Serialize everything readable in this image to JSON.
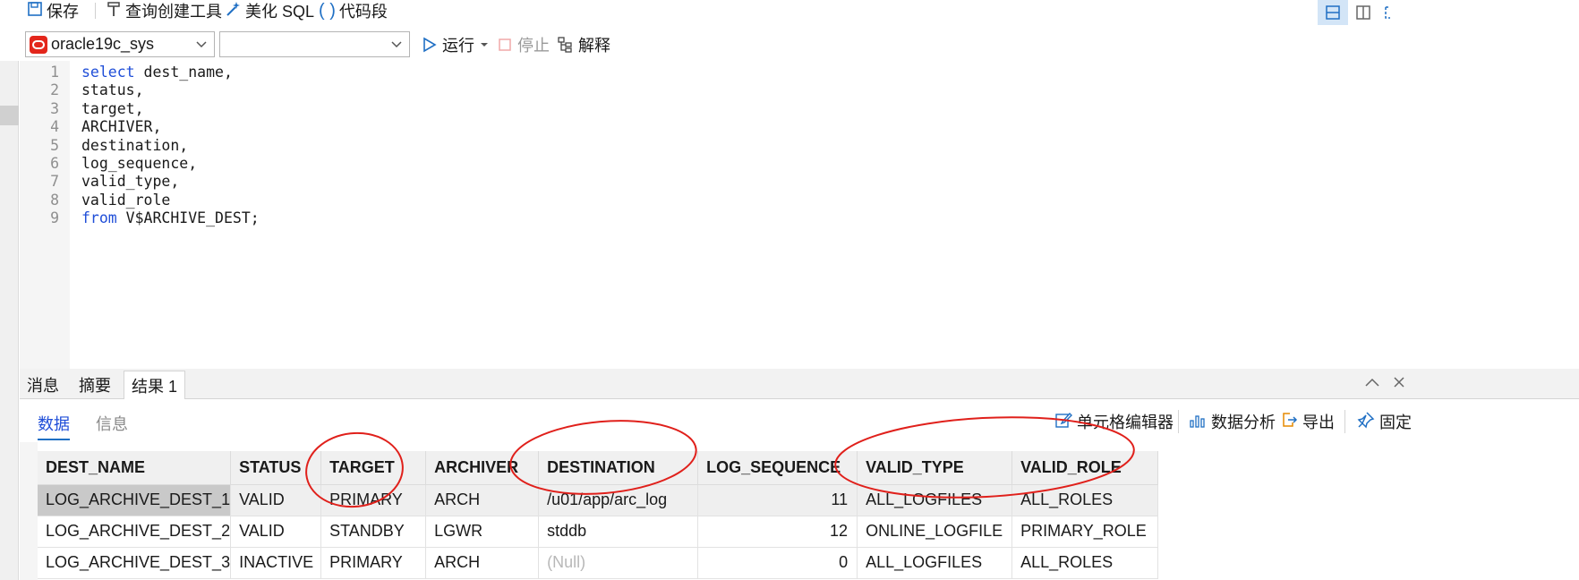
{
  "toolbar": {
    "save": "保存",
    "query_builder": "查询创建工具",
    "beautify": "美化 SQL",
    "snippet": "代码段"
  },
  "connection": {
    "selected": "oracle19c_sys",
    "schema": "",
    "run": "运行",
    "stop": "停止",
    "explain": "解释"
  },
  "editor": {
    "lines": [
      {
        "n": "1",
        "kw": "select",
        "text": " dest_name,"
      },
      {
        "n": "2",
        "kw": "",
        "text": "status,"
      },
      {
        "n": "3",
        "kw": "",
        "text": "target,"
      },
      {
        "n": "4",
        "kw": "",
        "text": "ARCHIVER,"
      },
      {
        "n": "5",
        "kw": "",
        "text": "destination,"
      },
      {
        "n": "6",
        "kw": "",
        "text": "log_sequence,"
      },
      {
        "n": "7",
        "kw": "",
        "text": "valid_type,"
      },
      {
        "n": "8",
        "kw": "",
        "text": "valid_role"
      },
      {
        "n": "9",
        "kw": "from",
        "text": " V$ARCHIVE_DEST;"
      }
    ]
  },
  "result_tabs": [
    "消息",
    "摘要",
    "结果 1"
  ],
  "sub_tabs": [
    "数据",
    "信息"
  ],
  "tools": {
    "cell_editor": "单元格编辑器",
    "data_analysis": "数据分析",
    "export": "导出",
    "pin": "固定"
  },
  "grid": {
    "columns": [
      "DEST_NAME",
      "STATUS",
      "TARGET",
      "ARCHIVER",
      "DESTINATION",
      "LOG_SEQUENCE",
      "VALID_TYPE",
      "VALID_ROLE"
    ],
    "rows": [
      [
        "LOG_ARCHIVE_DEST_1",
        "VALID",
        "PRIMARY",
        "ARCH",
        "/u01/app/arc_log",
        "11",
        "ALL_LOGFILES",
        "ALL_ROLES"
      ],
      [
        "LOG_ARCHIVE_DEST_2",
        "VALID",
        "STANDBY",
        "LGWR",
        "stddb",
        "12",
        "ONLINE_LOGFILE",
        "PRIMARY_ROLE"
      ],
      [
        "LOG_ARCHIVE_DEST_3",
        "INACTIVE",
        "PRIMARY",
        "ARCH",
        "(Null)",
        "0",
        "ALL_LOGFILES",
        "ALL_ROLES"
      ]
    ]
  },
  "colors": {
    "accent": "#1f6fc4",
    "annotation": "#e0201b",
    "keyword": "#1f4ed8"
  }
}
